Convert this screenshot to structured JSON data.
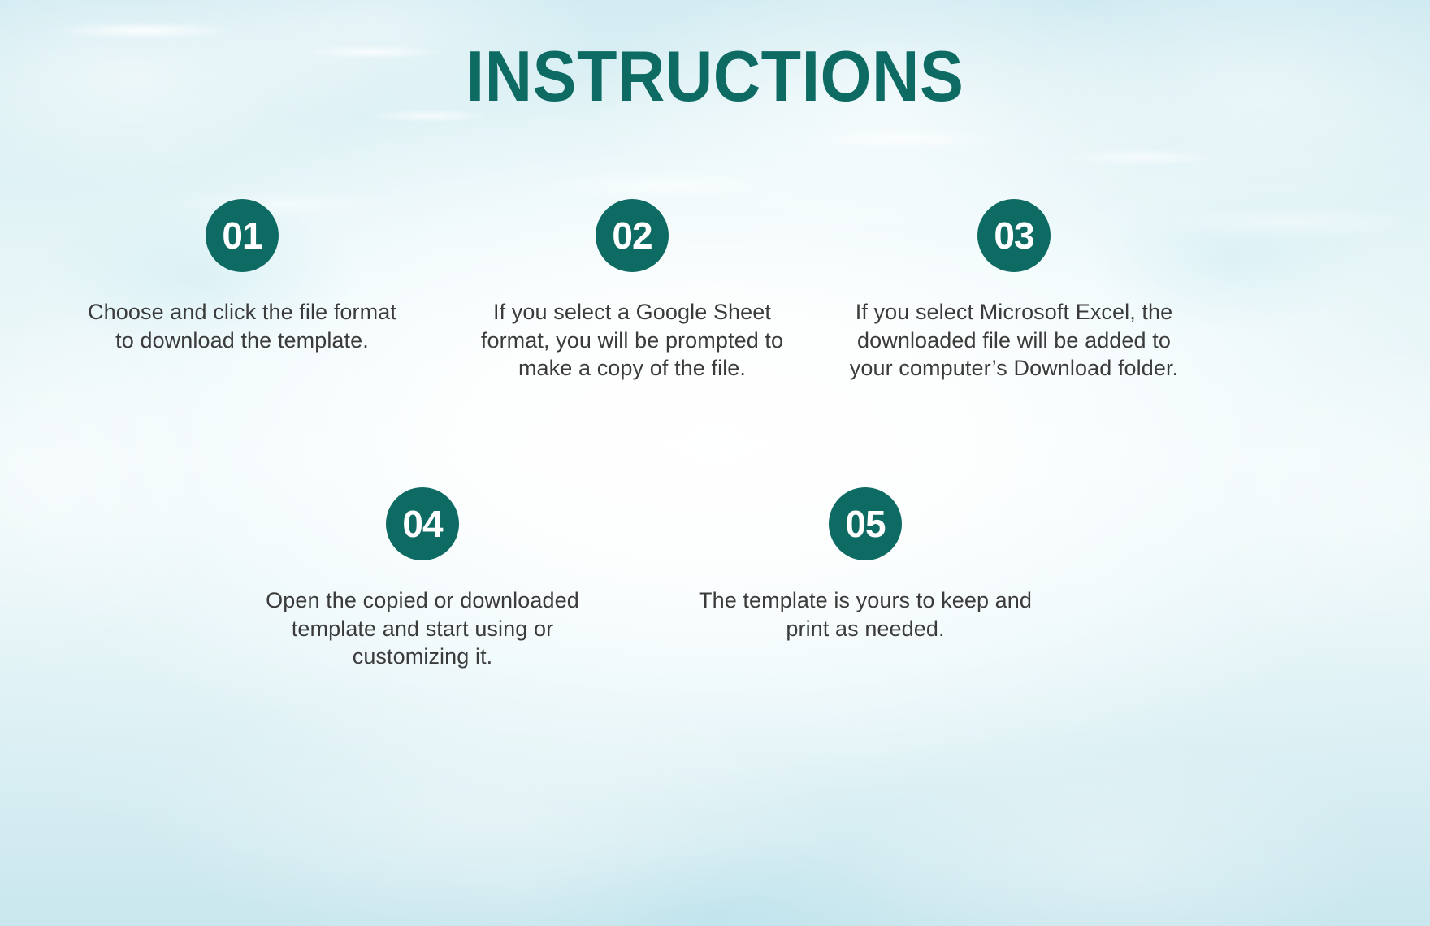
{
  "document": {
    "title": "INSTRUCTIONS",
    "background_style": "light-cyan-watercolor",
    "colors": {
      "accent_teal": "#0e6b63",
      "badge_number": "#ffffff",
      "body_text": "#3b3b3b",
      "background_light": "#eef8f9",
      "background_edge": "#cfeaf1"
    }
  },
  "steps": [
    {
      "number": "01",
      "text": "Choose and click the file format to download the template."
    },
    {
      "number": "02",
      "text": "If you select a Google Sheet format, you will be prompted to make a copy of the file."
    },
    {
      "number": "03",
      "text": "If you select Microsoft Excel, the downloaded file will be added to your computer’s Download  folder."
    },
    {
      "number": "04",
      "text": "Open the copied or downloaded template and start using or customizing it."
    },
    {
      "number": "05",
      "text": "The template is yours to keep and print as needed."
    }
  ]
}
